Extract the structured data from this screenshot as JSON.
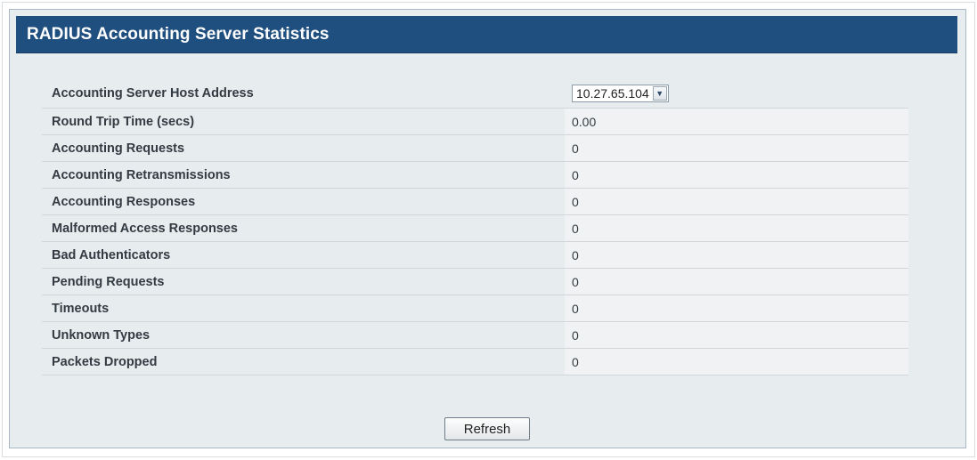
{
  "title": "RADIUS Accounting Server Statistics",
  "host_address": {
    "label": "Accounting Server Host Address",
    "selected": "10.27.65.104"
  },
  "stats": [
    {
      "label": "Round Trip Time (secs)",
      "value": "0.00"
    },
    {
      "label": "Accounting Requests",
      "value": "0"
    },
    {
      "label": "Accounting Retransmissions",
      "value": "0"
    },
    {
      "label": "Accounting Responses",
      "value": "0"
    },
    {
      "label": "Malformed Access Responses",
      "value": "0"
    },
    {
      "label": "Bad Authenticators",
      "value": "0"
    },
    {
      "label": "Pending Requests",
      "value": "0"
    },
    {
      "label": "Timeouts",
      "value": "0"
    },
    {
      "label": "Unknown Types",
      "value": "0"
    },
    {
      "label": "Packets Dropped",
      "value": "0"
    }
  ],
  "refresh_label": "Refresh",
  "colors": {
    "title_bar": "#1f4f7f",
    "panel_bg": "#e7ecef",
    "value_bg": "#f0f2f3"
  }
}
